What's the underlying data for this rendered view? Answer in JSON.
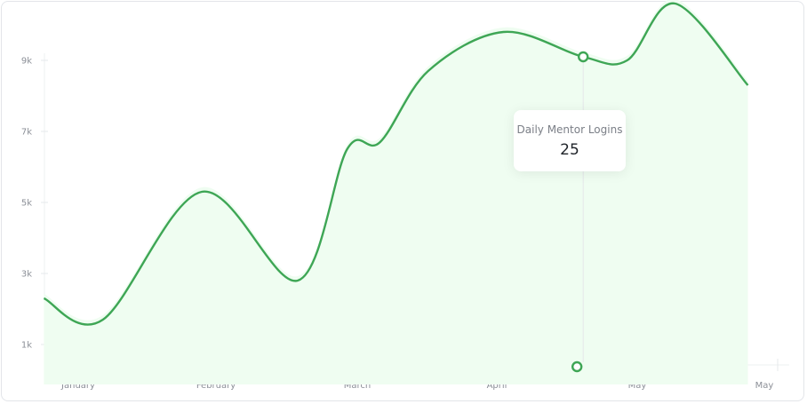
{
  "chart_data": {
    "type": "area",
    "x_labels": [
      "January",
      "February",
      "March",
      "April",
      "May",
      "May"
    ],
    "y_ticks": [
      {
        "label": "1k",
        "value": 1000
      },
      {
        "label": "3k",
        "value": 3000
      },
      {
        "label": "5k",
        "value": 5000
      },
      {
        "label": "7k",
        "value": 7000
      },
      {
        "label": "9k",
        "value": 9000
      }
    ],
    "ylim": [
      0,
      10000
    ],
    "x_range": [
      0,
      5
    ],
    "series": [
      {
        "x": [
          -0.25,
          0.18,
          0.9,
          1.6,
          1.96,
          2.2,
          2.55,
          3.1,
          3.68,
          4.0,
          4.35,
          4.88
        ],
        "y": [
          2300,
          1700,
          5300,
          2800,
          6500,
          6700,
          8700,
          9800,
          9100,
          9000,
          10600,
          8300
        ],
        "color": "#3ea655",
        "fill": "#effdf1"
      }
    ],
    "hover": {
      "x": 3.68,
      "title": "Daily Mentor Logins",
      "value": "25"
    },
    "grid": false
  }
}
